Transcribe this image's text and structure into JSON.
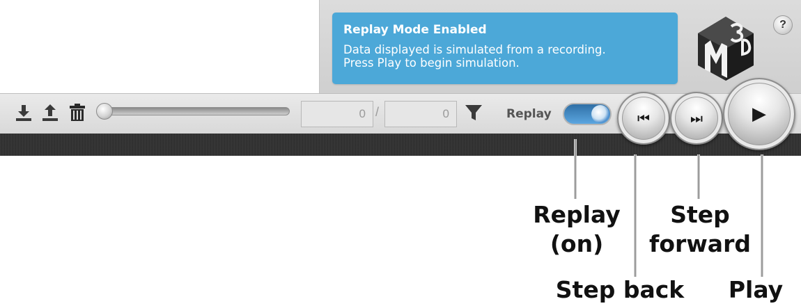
{
  "notice": {
    "title": "Replay Mode Enabled",
    "line1": "Data displayed is simulated from a recording.",
    "line2": "Press Play to begin simulation."
  },
  "logo": {
    "text": "3DM"
  },
  "help": {
    "label": "?"
  },
  "toolbar": {
    "current_count": "0",
    "separator": "/",
    "total_count": "0",
    "replay_label": "Replay",
    "replay_on": true,
    "icons": [
      "download-icon",
      "upload-icon",
      "trash-icon",
      "filter-icon"
    ]
  },
  "buttons": {
    "step_back_glyph": "⏮",
    "step_forward_glyph": "⏭",
    "play_glyph": "▶"
  },
  "annotations": {
    "replay_line1": "Replay",
    "replay_line2": "(on)",
    "step_back": "Step back",
    "step_forward_line1": "Step",
    "step_forward_line2": "forward",
    "play": "Play"
  },
  "colors": {
    "notice_bg": "#4ca8d8",
    "toggle_on": "#4b8fd0"
  }
}
